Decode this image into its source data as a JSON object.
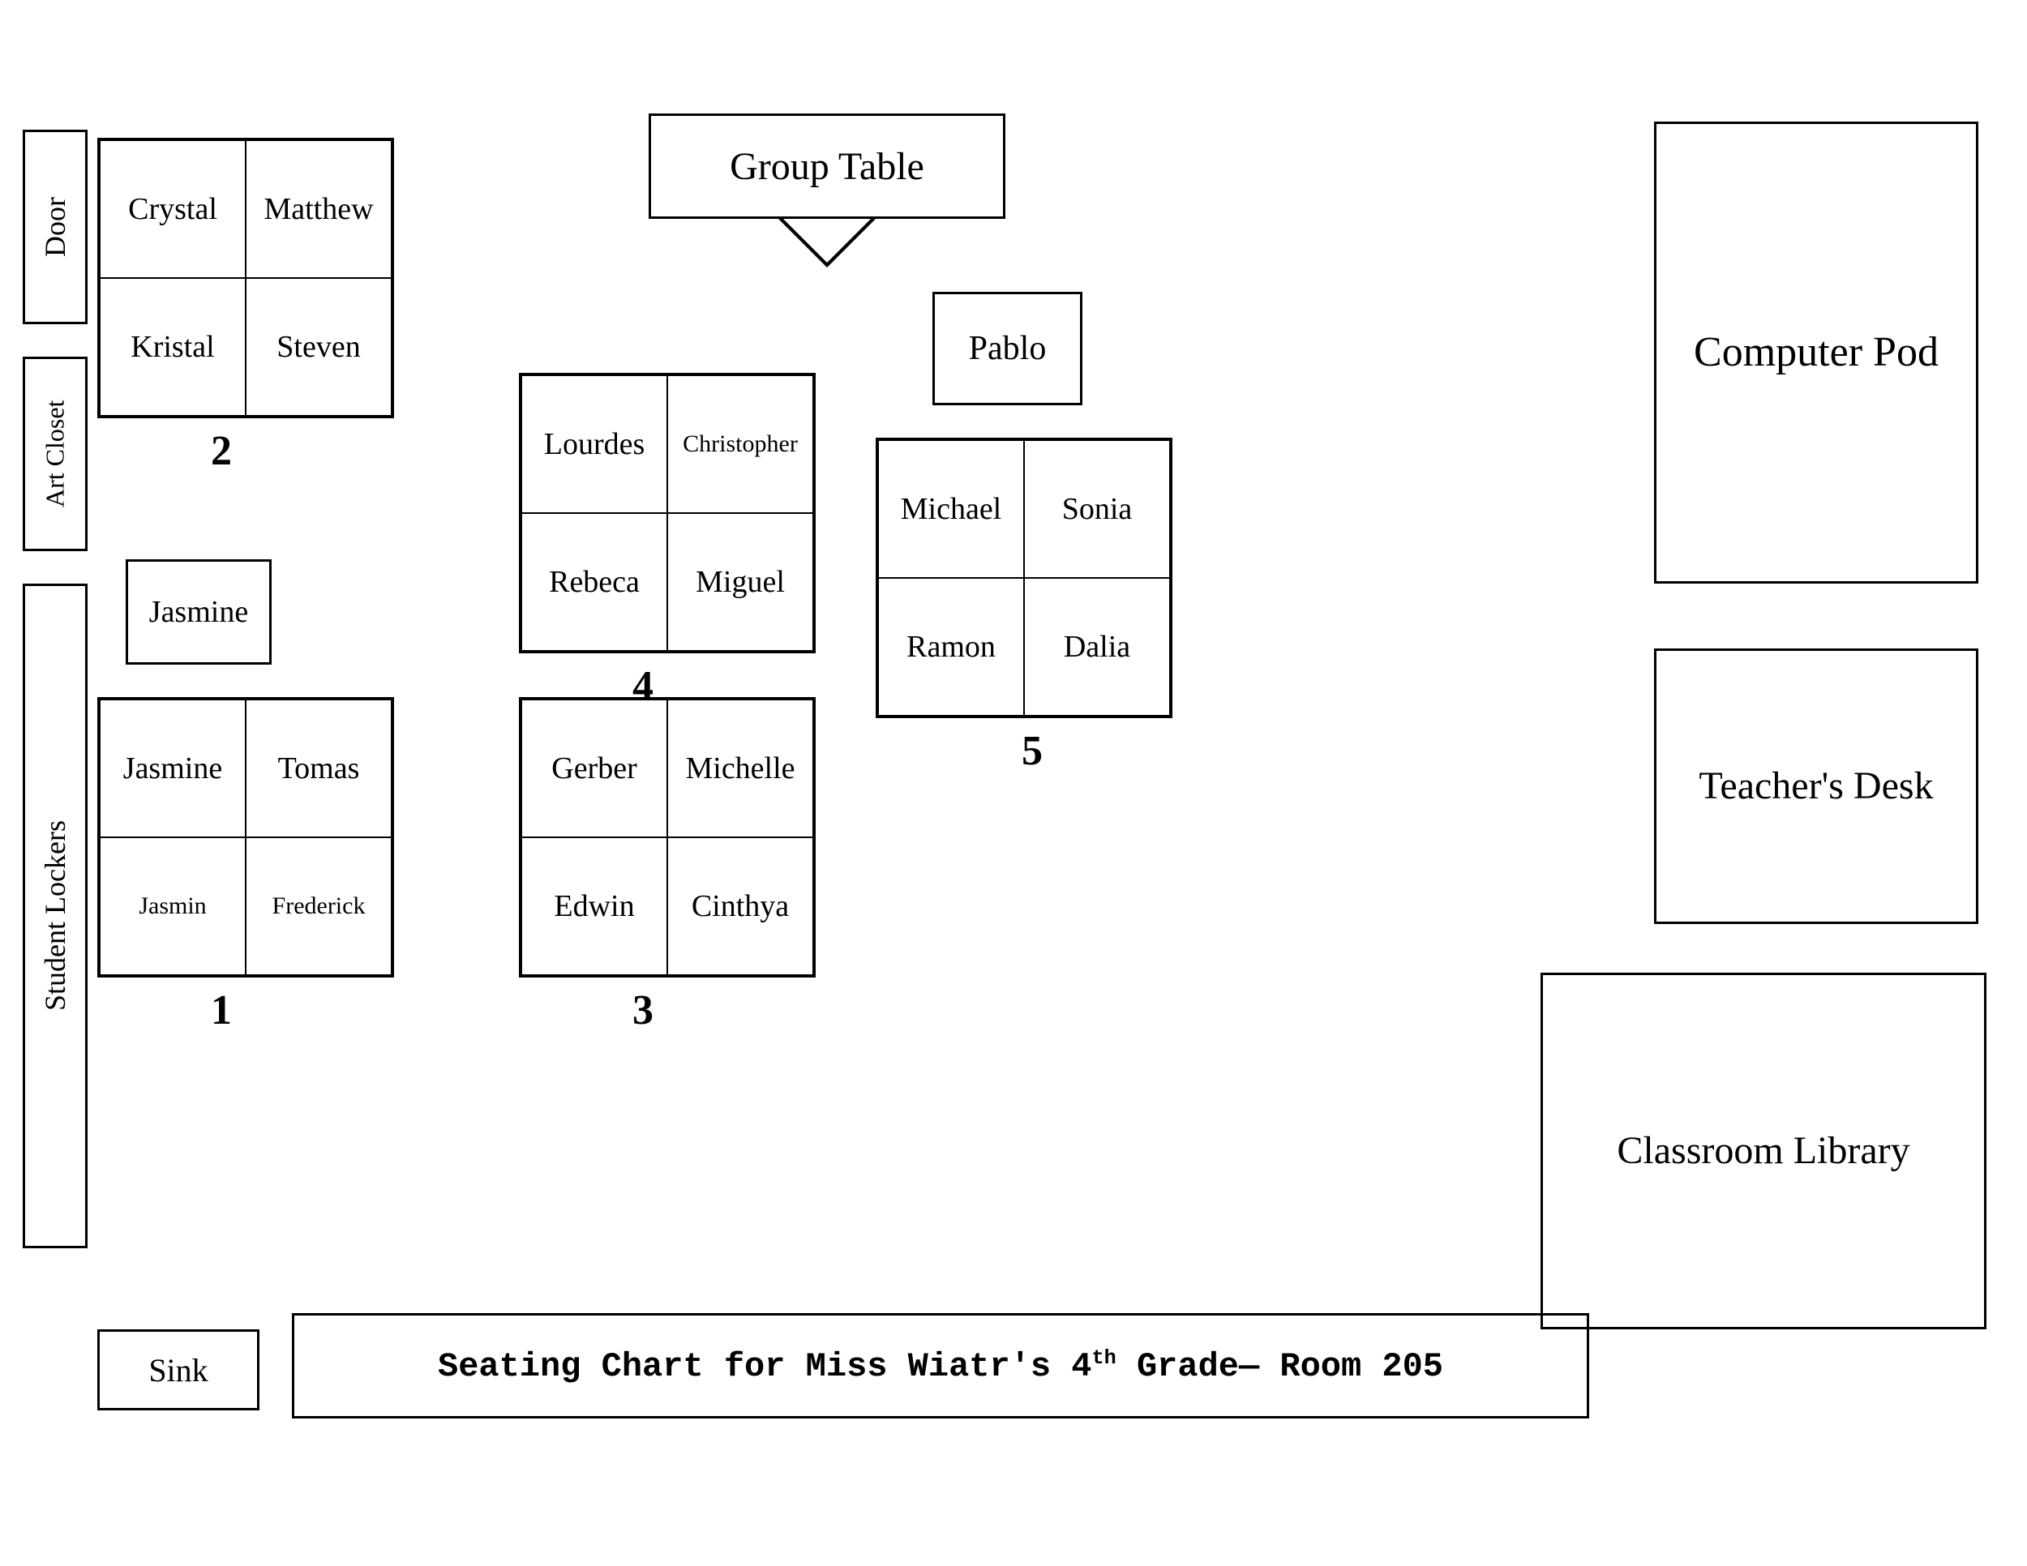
{
  "title": "Seating Chart for Miss Wiatr's 4th Grade— Room 205",
  "room": {
    "door": "Door",
    "art_closet": "Art Closet",
    "student_lockers": "Student Lockers",
    "sink": "Sink",
    "computer_pod": "Computer Pod",
    "teachers_desk": "Teacher's Desk",
    "classroom_library": "Classroom Library",
    "group_table": "Group Table"
  },
  "groups": [
    {
      "number": "2",
      "students": [
        "Crystal",
        "Matthew",
        "Kristal",
        "Steven"
      ]
    },
    {
      "number": "1",
      "students": [
        "Jasmine",
        "Tomas",
        "Jasmin",
        "Frederick"
      ],
      "solo": "Jasmine"
    },
    {
      "number": "4",
      "students": [
        "Lourdes",
        "Christopher",
        "Rebeca",
        "Miguel"
      ]
    },
    {
      "number": "3",
      "students": [
        "Gerber",
        "Michelle",
        "Edwin",
        "Cinthya"
      ]
    },
    {
      "number": "5",
      "students": [
        "Michael",
        "Sonia",
        "Ramon",
        "Dalia"
      ],
      "top": "Pablo"
    }
  ]
}
